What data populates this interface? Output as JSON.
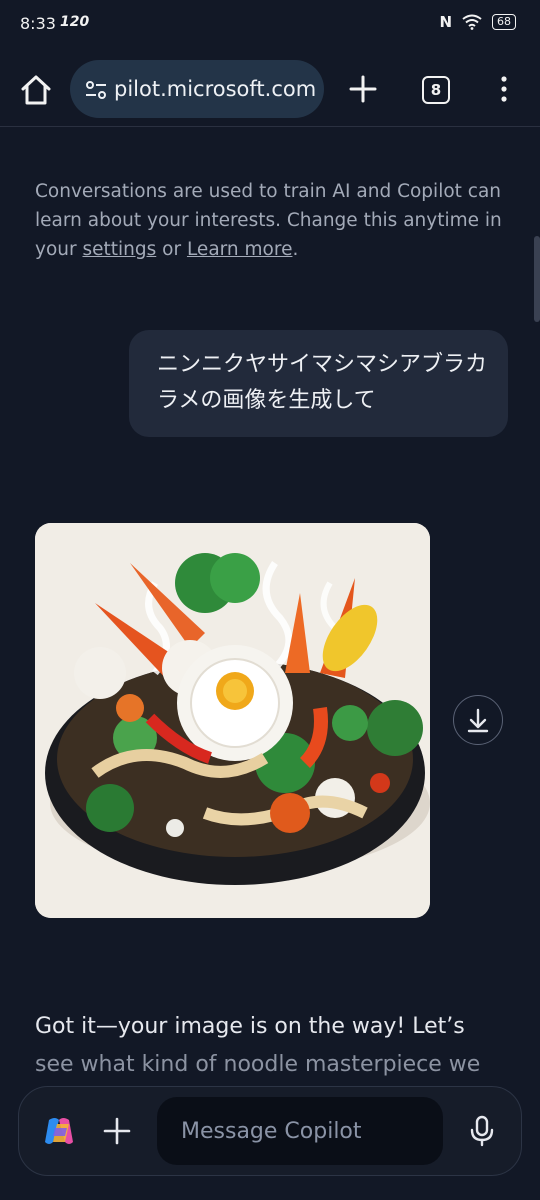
{
  "status_bar": {
    "time": "8:33",
    "refresh_rate": "120",
    "battery": "68"
  },
  "browser": {
    "url_display": "pilot.microsoft.com",
    "tab_count": "8"
  },
  "notice": {
    "text_before": "Conversations are used to train AI and Copilot can learn about your interests. Change this anytime in your ",
    "settings_link": "settings",
    "between": " or ",
    "learn_more_link": "Learn more",
    "after": "."
  },
  "user_message": "ニンニクヤサイマシマシアブラカラメの画像を生成して",
  "copilot_reply": {
    "line1": "Got it—your image is on the way! Let’s",
    "line2": "see what kind of noodle masterpiece we"
  },
  "composer": {
    "placeholder": "Message Copilot"
  },
  "icons": {
    "home": "home-icon",
    "site_settings": "tune-icon",
    "new_tab": "plus-icon",
    "menu": "more-vertical-icon",
    "download": "download-icon",
    "mic": "microphone-icon",
    "logo": "copilot-logo"
  }
}
